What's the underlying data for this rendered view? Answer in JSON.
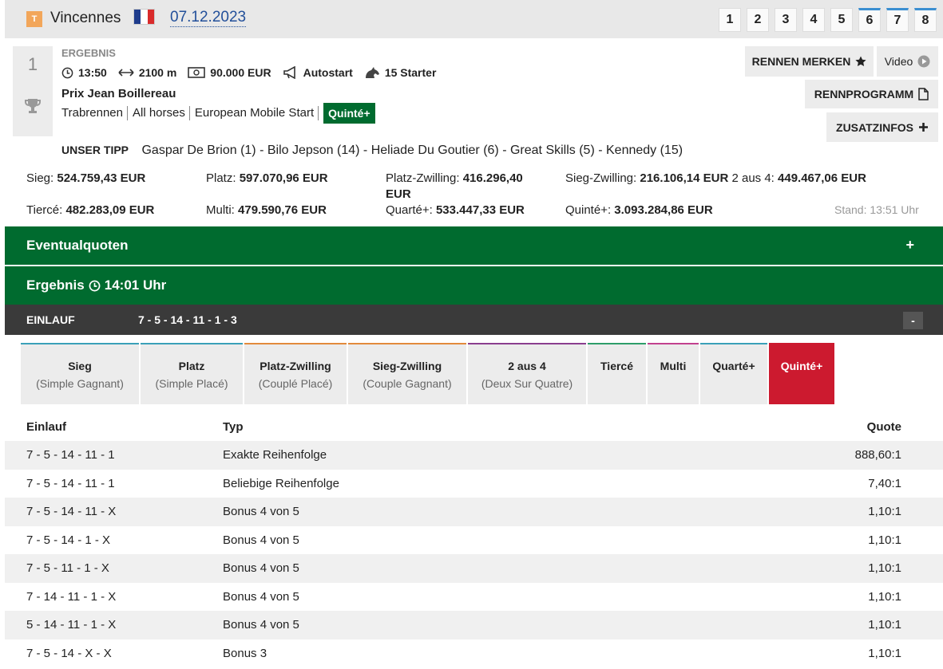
{
  "header": {
    "track_badge": "T",
    "track": "Vincennes",
    "date": "07.12.2023",
    "race_numbers": [
      "1",
      "2",
      "3",
      "4",
      "5",
      "6",
      "7",
      "8"
    ]
  },
  "race": {
    "number": "1",
    "status_label": "ERGEBNIS",
    "time": "13:50",
    "distance": "2100 m",
    "prize": "90.000 EUR",
    "start_type": "Autostart",
    "starters": "15 Starter",
    "title": "Prix Jean Boillereau",
    "tags": [
      "Trabrennen",
      "All horses",
      "European Mobile Start"
    ],
    "quinte_badge": "Quinté+"
  },
  "buttons": {
    "merken": "RENNEN MERKEN",
    "video": "Video",
    "programm": "RENNPROGRAMM",
    "zusatz": "ZUSATZINFOS"
  },
  "tipp": {
    "label": "UNSER TIPP",
    "text": "Gaspar De Brion (1) - Bilo Jepson (14) - Heliade Du Goutier (6) - Great Skills (5) - Kennedy (15)"
  },
  "payouts": {
    "sieg_label": "Sieg:",
    "sieg": "524.759,43 EUR",
    "platz_label": "Platz:",
    "platz": "597.070,96 EUR",
    "pz_label": "Platz-Zwilling:",
    "pz_1": "416.296,40",
    "pz_2": "EUR",
    "sz_label": "Sieg-Zwilling:",
    "sz": "216.106,14 EUR",
    "zv_label": "2 aus 4:",
    "zv": "449.467,06 EUR",
    "tierce_label": "Tiercé:",
    "tierce": "482.283,09 EUR",
    "multi_label": "Multi:",
    "multi": "479.590,76 EUR",
    "quarte_label": "Quarté+:",
    "quarte": "533.447,33 EUR",
    "quinte_label": "Quinté+:",
    "quinte": "3.093.284,86 EUR",
    "stand": "Stand: 13:51 Uhr"
  },
  "sections": {
    "eventual": "Eventualquoten",
    "eventual_toggle": "+",
    "ergebnis": "Ergebnis",
    "ergebnis_time": "14:01 Uhr",
    "einlauf_label": "EINLAUF",
    "einlauf_value": "7 - 5 - 14 - 11 - 1 - 3",
    "einlauf_toggle": "-"
  },
  "tabs": [
    {
      "main": "Sieg",
      "sub": "(Simple Gagnant)",
      "color": "#3aa0b8"
    },
    {
      "main": "Platz",
      "sub": "(Simple Placé)",
      "color": "#3aa0b8"
    },
    {
      "main": "Platz-Zwilling",
      "sub": "(Couplé Placé)",
      "color": "#e28a3c"
    },
    {
      "main": "Sieg-Zwilling",
      "sub": "(Couple Gagnant)",
      "color": "#e28a3c"
    },
    {
      "main": "2 aus 4",
      "sub": "(Deux Sur Quatre)",
      "color": "#8a3e8f"
    },
    {
      "main": "Tiercé",
      "sub": "",
      "color": "#2e9e6a"
    },
    {
      "main": "Multi",
      "sub": "",
      "color": "#c2418f"
    },
    {
      "main": "Quarté+",
      "sub": "",
      "color": "#3aa0b8"
    },
    {
      "main": "Quinté+",
      "sub": "",
      "color": "#cc1a2f"
    }
  ],
  "table": {
    "headers": [
      "Einlauf",
      "Typ",
      "Quote"
    ],
    "rows": [
      [
        "7 - 5 - 14 - 11 - 1",
        "Exakte Reihenfolge",
        "888,60:1"
      ],
      [
        "7 - 5 - 14 - 11 - 1",
        "Beliebige Reihenfolge",
        "7,40:1"
      ],
      [
        "7 - 5 - 14 - 11 - X",
        "Bonus 4 von 5",
        "1,10:1"
      ],
      [
        "7 - 5 - 14 - 1 - X",
        "Bonus 4 von 5",
        "1,10:1"
      ],
      [
        "7 - 5 - 11 - 1 - X",
        "Bonus 4 von 5",
        "1,10:1"
      ],
      [
        "7 - 14 - 11 - 1 - X",
        "Bonus 4 von 5",
        "1,10:1"
      ],
      [
        "5 - 14 - 11 - 1 - X",
        "Bonus 4 von 5",
        "1,10:1"
      ],
      [
        "7 - 5 - 14 - X - X",
        "Bonus 3",
        "1,10:1"
      ]
    ]
  },
  "colors": {
    "green": "#006b2f",
    "active_tab": "#cc1a2f",
    "link": "#23509a"
  }
}
